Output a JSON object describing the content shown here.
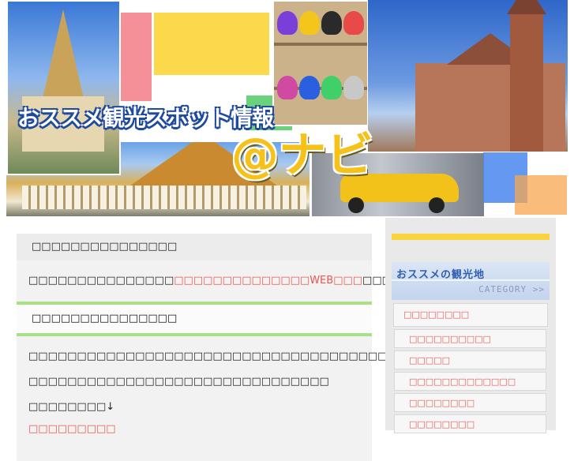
{
  "header": {
    "site_title": "おススメ観光スポット情報",
    "logo": "@ナビ"
  },
  "main": {
    "box1": {
      "title": "□□□□□□□□□□□□□□□",
      "text_before": "□□□□□□□□□□□□□□□",
      "link": "□□□□□□□□□□□□□□WEB□□□",
      "text_after": "□□□□□□□□□□□□□"
    },
    "box2": {
      "title": "□□□□□□□□□□□□□□□",
      "para1": "□□□□□□□□□□□□□□□□□□□□□□□□□□□□□□□□□□□□□□□□□□□□□□□□□□",
      "para2": "□□□□□□□□□□□□□□□□□□□□□□□□□□□□□□□",
      "para3": "□□□□□□□□↓",
      "link": "□□□□□□□□□"
    }
  },
  "sidebar": {
    "heading": "おススメの観光地",
    "sub": "CATEGORY >>",
    "items": [
      {
        "label": "□□□□□□□□"
      },
      {
        "label": "□□□□□□□□□□"
      },
      {
        "label": "□□□□□"
      },
      {
        "label": "□□□□□□□□□□□□□"
      },
      {
        "label": "□□□□□□□□"
      },
      {
        "label": "□□□□□□□□"
      }
    ]
  },
  "colors": {
    "link": "#e8564f",
    "divider": "#a8e08a",
    "sidebar_accent": "#fad43f",
    "heading_blue": "#2e5fb0"
  }
}
